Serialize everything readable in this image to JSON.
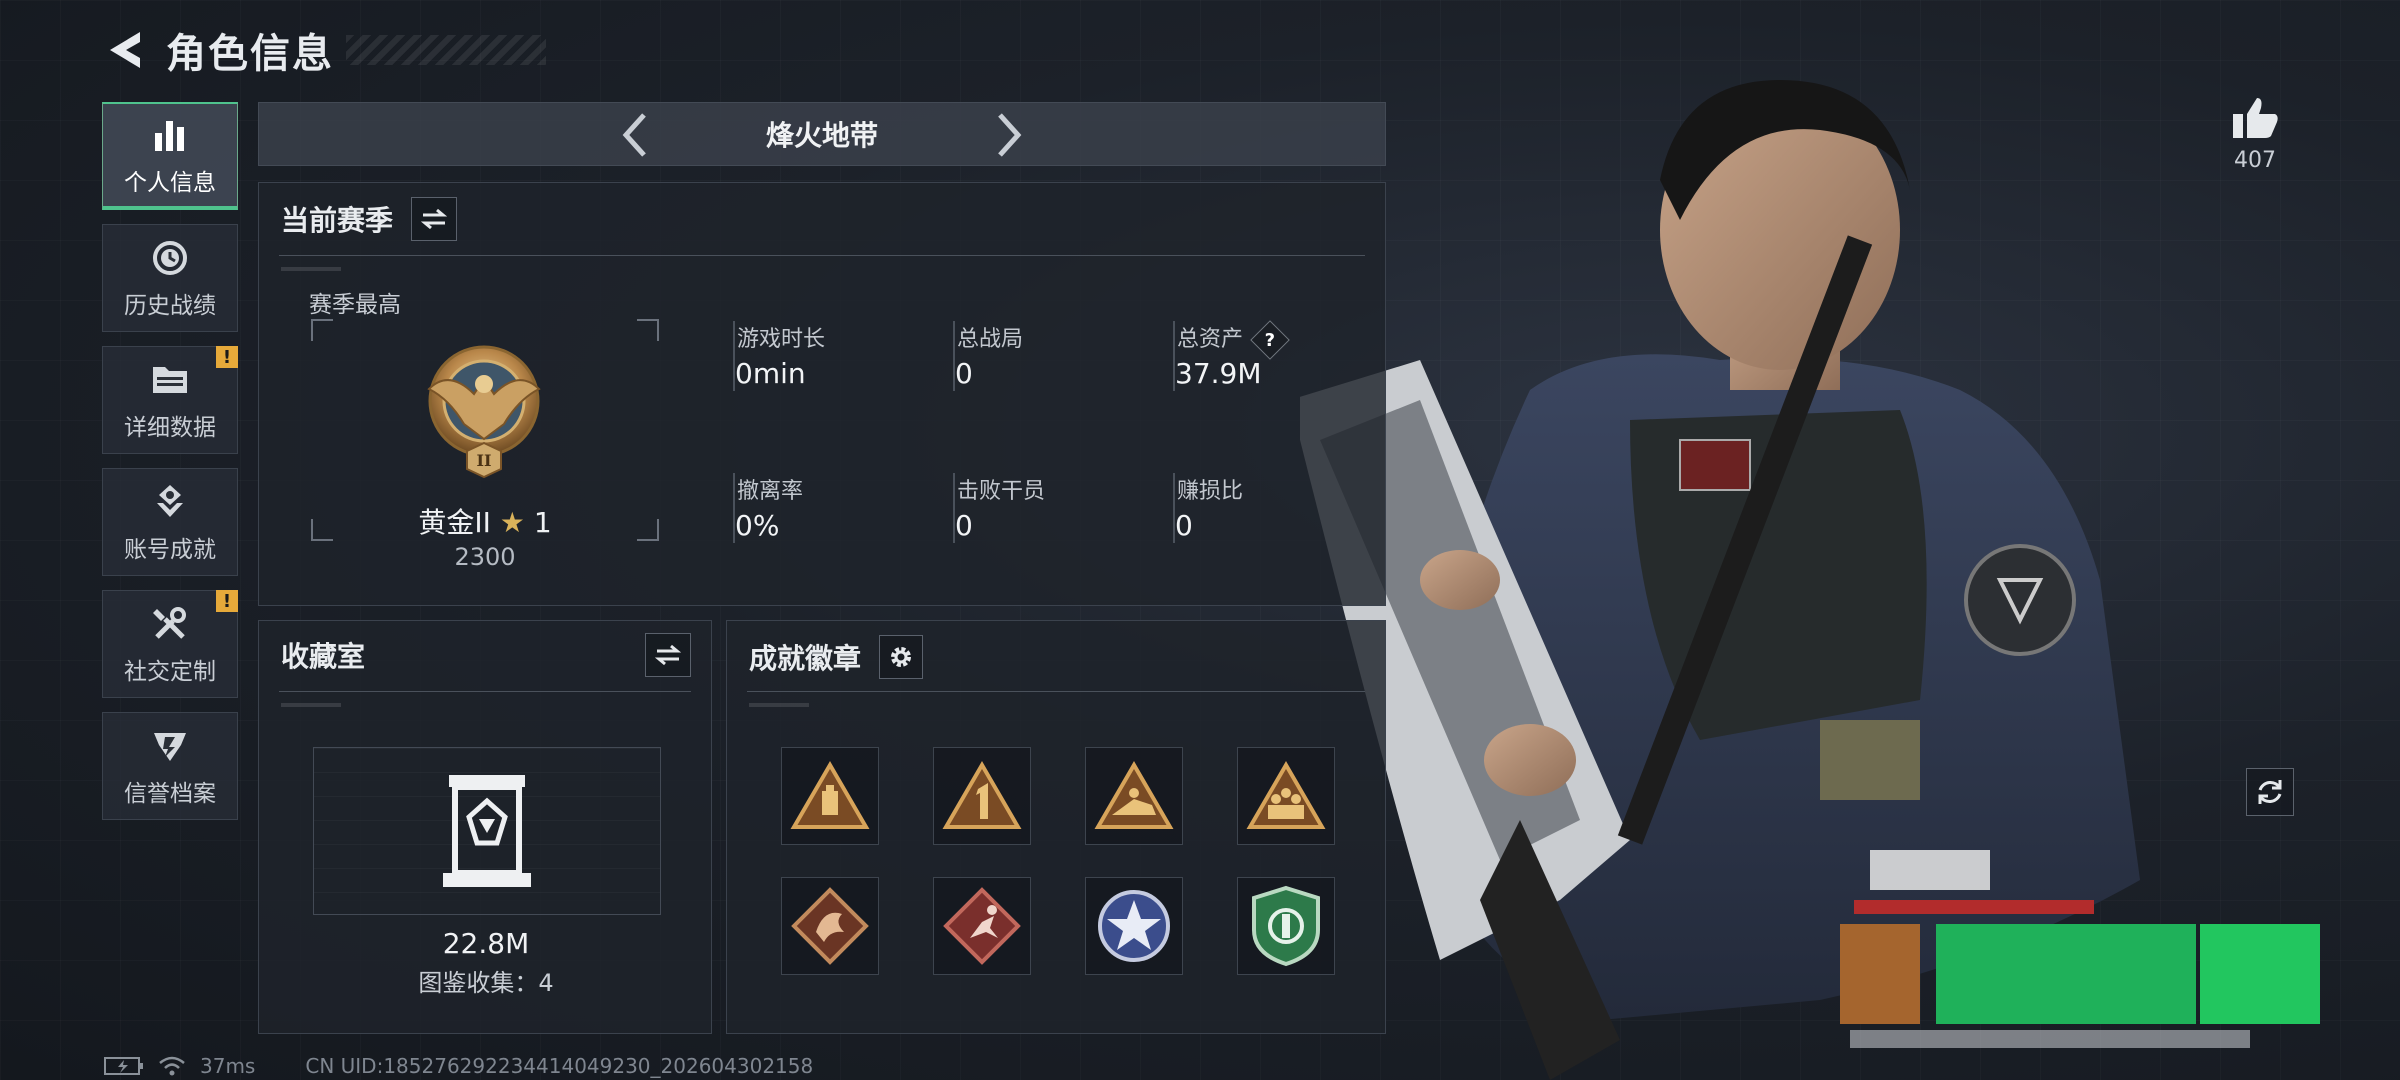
{
  "header": {
    "title": "角色信息"
  },
  "sidebar": {
    "items": [
      {
        "label": "个人信息",
        "icon": "bar-chart-icon",
        "active": true,
        "alert": false
      },
      {
        "label": "历史战绩",
        "icon": "history-icon",
        "active": false,
        "alert": false
      },
      {
        "label": "详细数据",
        "icon": "folder-icon",
        "active": false,
        "alert": true
      },
      {
        "label": "账号成就",
        "icon": "achievement-icon",
        "active": false,
        "alert": false
      },
      {
        "label": "社交定制",
        "icon": "tools-icon",
        "active": false,
        "alert": true
      },
      {
        "label": "信誉档案",
        "icon": "reputation-icon",
        "active": false,
        "alert": false
      }
    ],
    "alert_mark": "!"
  },
  "mode_selector": {
    "title": "烽火地带"
  },
  "season": {
    "title": "当前赛季",
    "best_label": "赛季最高",
    "rank_name": "黄金II",
    "rank_star": "★",
    "rank_stars": "1",
    "rank_score": "2300",
    "medal_tier": "II",
    "stats": [
      {
        "label": "游戏时长",
        "value": "0min"
      },
      {
        "label": "总战局",
        "value": "0"
      },
      {
        "label": "总资产",
        "value": "37.9M",
        "help": "?"
      },
      {
        "label": "撤离率",
        "value": "0%"
      },
      {
        "label": "击败干员",
        "value": "0"
      },
      {
        "label": "赚损比",
        "value": "0"
      }
    ]
  },
  "collection": {
    "title": "收藏室",
    "value": "22.8M",
    "count_text": "图鉴收集：4"
  },
  "badges": {
    "title": "成就徽章",
    "items": [
      "supply-triangle-badge",
      "number-one-badge",
      "prone-soldier-badge",
      "squad-triangle-badge",
      "dragon-diamond-badge",
      "runner-diamond-badge",
      "star-round-badge",
      "shield-green-badge"
    ]
  },
  "likes": {
    "count": "407"
  },
  "status": {
    "ping": "37ms",
    "uid": "CN UID:1852762922344140492​30_202604302158"
  },
  "colors": {
    "accent_green": "#4fc38d",
    "gold": "#d9b25a",
    "alert": "#e6a93a",
    "panel_bg": "#1e232b"
  }
}
